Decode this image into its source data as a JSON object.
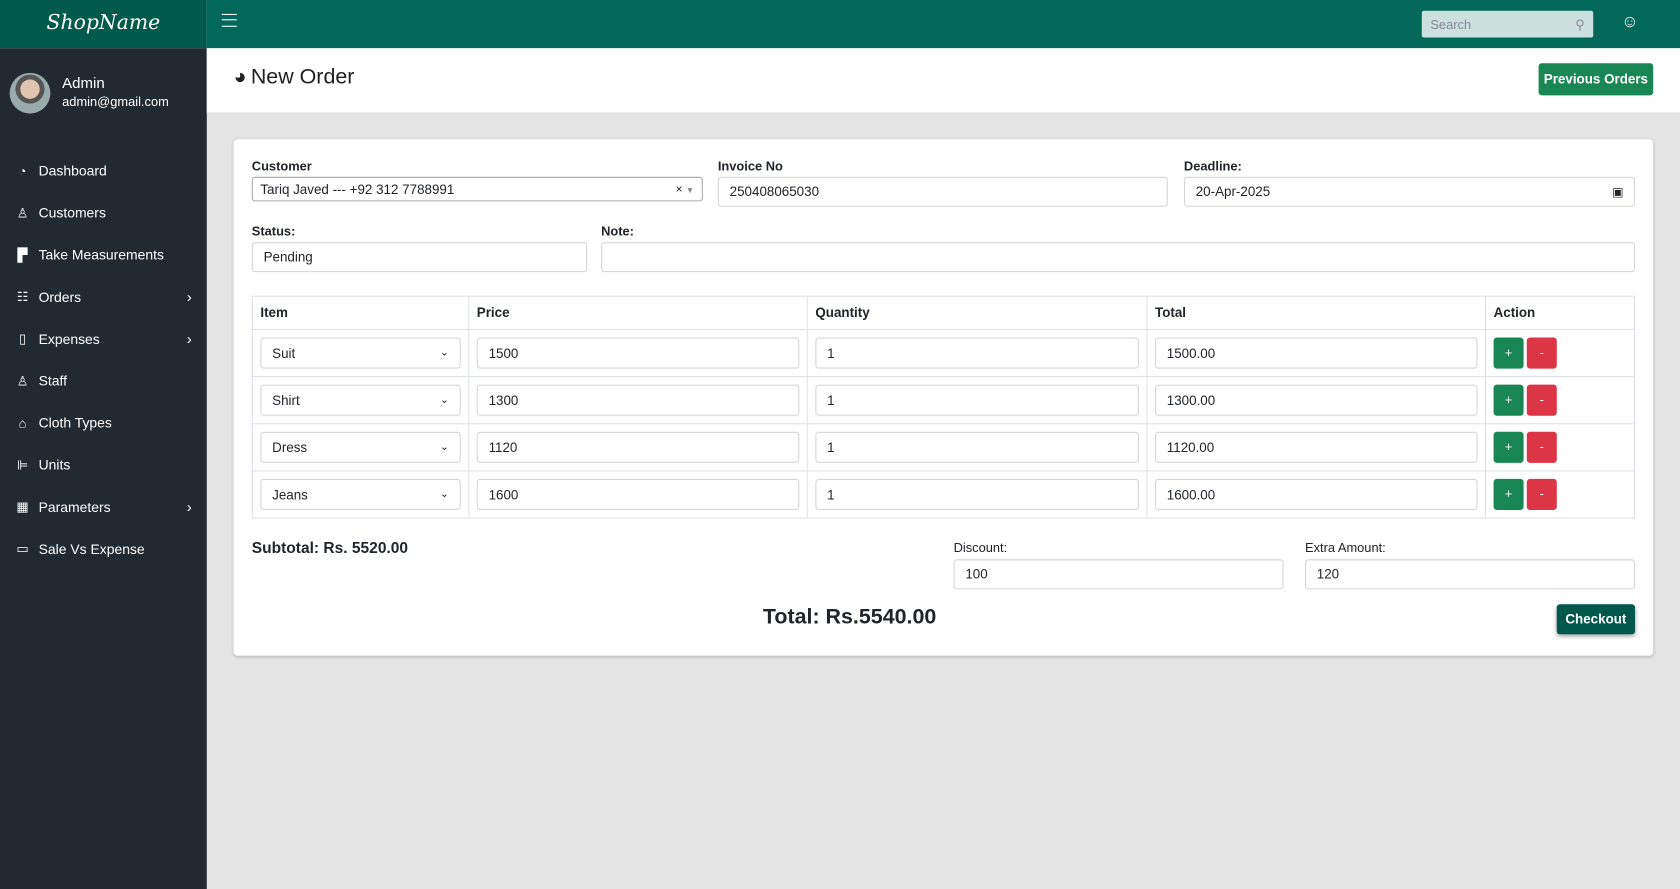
{
  "brand": "ShopName",
  "user": {
    "name": "Admin",
    "email": "admin@gmail.com"
  },
  "nav": [
    {
      "label": "Dashboard",
      "icon": "dashboard-icon",
      "chevron": false
    },
    {
      "label": "Customers",
      "icon": "user-icon",
      "chevron": false
    },
    {
      "label": "Take Measurements",
      "icon": "ruler-icon",
      "chevron": false
    },
    {
      "label": "Orders",
      "icon": "list-icon",
      "chevron": true
    },
    {
      "label": "Expenses",
      "icon": "file-icon",
      "chevron": true
    },
    {
      "label": "Staff",
      "icon": "user-icon",
      "chevron": false
    },
    {
      "label": "Cloth Types",
      "icon": "bag-icon",
      "chevron": false
    },
    {
      "label": "Units",
      "icon": "units-icon",
      "chevron": false
    },
    {
      "label": "Parameters",
      "icon": "table-icon",
      "chevron": true
    },
    {
      "label": "Sale Vs Expense",
      "icon": "window-icon",
      "chevron": false
    }
  ],
  "search": {
    "placeholder": "Search"
  },
  "page": {
    "title": "New Order",
    "previous_orders": "Previous Orders"
  },
  "form": {
    "customer_label": "Customer",
    "customer_value": "Tariq Javed --- +92 312 7788991",
    "invoice_label": "Invoice No",
    "invoice_value": "250408065030",
    "deadline_label": "Deadline:",
    "deadline_value": "20-Apr-2025",
    "status_label": "Status:",
    "status_value": "Pending",
    "note_label": "Note:",
    "note_value": ""
  },
  "table": {
    "headers": [
      "Item",
      "Price",
      "Quantity",
      "Total",
      "Action"
    ],
    "rows": [
      {
        "item": "Suit",
        "price": "1500",
        "qty": "1",
        "total": "1500.00"
      },
      {
        "item": "Shirt",
        "price": "1300",
        "qty": "1",
        "total": "1300.00"
      },
      {
        "item": "Dress",
        "price": "1120",
        "qty": "1",
        "total": "1120.00"
      },
      {
        "item": "Jeans",
        "price": "1600",
        "qty": "1",
        "total": "1600.00"
      }
    ],
    "add": "+",
    "remove": "-"
  },
  "summary": {
    "subtotal": "Subtotal: Rs. 5520.00",
    "discount_label": "Discount:",
    "discount_value": "100",
    "extra_label": "Extra Amount:",
    "extra_value": "120",
    "total": "Total: Rs.5540.00",
    "checkout": "Checkout"
  },
  "colors": {
    "topbar": "#02695a",
    "sidebar": "#212a31",
    "success": "#198754",
    "danger": "#dc3545"
  }
}
